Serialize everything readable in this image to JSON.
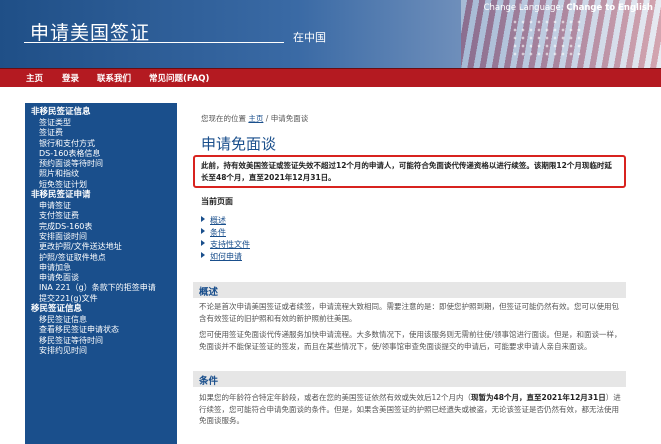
{
  "header": {
    "site_title": "申请美国签证",
    "subtitle": "在中国",
    "lang_prefix": "Change Language:",
    "lang_link": "Change to English"
  },
  "nav": [
    "主页",
    "登录",
    "联系我们",
    "常见问题(FAQ)"
  ],
  "sidebar": [
    {
      "label": "非移民签证信息",
      "head": true
    },
    {
      "label": "签证类型",
      "head": false
    },
    {
      "label": "签证费",
      "head": false
    },
    {
      "label": "银行和支付方式",
      "head": false
    },
    {
      "label": "DS-160表格信息",
      "head": false
    },
    {
      "label": "预约面谈等待时间",
      "head": false
    },
    {
      "label": "照片和指纹",
      "head": false
    },
    {
      "label": "短免签证计划",
      "head": false
    },
    {
      "label": "非移民签证申请",
      "head": true
    },
    {
      "label": "申请签证",
      "head": false
    },
    {
      "label": "支付签证费",
      "head": false
    },
    {
      "label": "完成DS-160表",
      "head": false
    },
    {
      "label": "安排面谈时间",
      "head": false
    },
    {
      "label": "更改护照/文件送达地址",
      "head": false
    },
    {
      "label": "护照/签证取件地点",
      "head": false
    },
    {
      "label": "申请加急",
      "head": false
    },
    {
      "label": "申请免面谈",
      "head": false
    },
    {
      "label": "INA 221（g）条款下的拒签申请",
      "head": false
    },
    {
      "label": "提交221(g)文件",
      "head": false
    },
    {
      "label": "移民签证信息",
      "head": true
    },
    {
      "label": "移民签证信息",
      "head": false
    },
    {
      "label": "查看移民签证申请状态",
      "head": false
    },
    {
      "label": "移民签证等待时间",
      "head": false
    },
    {
      "label": "安排约见时间",
      "head": false
    }
  ],
  "breadcrumb": {
    "prefix": "您现在的位置",
    "home": "主页",
    "sep": "/",
    "current": "申请免面谈"
  },
  "page_title": "申请免面谈",
  "notice": "此前，持有效美国签证或签证失效不超过12个月的申请人，可能符合免面谈代传递资格以进行续签。该期限12个月现临时延长至48个月，直至2021年12月31日。",
  "current_page_label": "当前页面",
  "page_links": [
    "概述",
    "条件",
    "支持性文件",
    "如何申请"
  ],
  "sections": {
    "overview": {
      "title": "概述",
      "p1": "不论是首次申请美国签证或者续签，申请流程大致相同。需要注意的是：即使您护照到期，但签证可能仍然有效。您可以使用包含有效签证的旧护照和有效的新护照前往美国。",
      "p2": "您可使用签证免面谈代传递服务加快申请流程。大多数情况下，使用该服务则无需前往使/领事馆进行面谈。但是，和面谈一样，免面谈并不能保证签证的签发，而且在某些情况下，使/领事馆审查免面谈提交的申请后，可能要求申请人亲自来面谈。"
    },
    "conditions": {
      "title": "条件",
      "p1_pre": "如果您的年龄符合特定年龄段，或者在您的美国签证依然有效或失效后12个月内（",
      "p1_bold": "现暂为48个月，直至2021年12月31日",
      "p1_post": "）进行续签，您可能符合申请免面谈的条件。但是，如果含美国签证的护照已经遗失或被盗，无论该签证是否仍然有效，都无法使用免面谈服务。"
    }
  }
}
